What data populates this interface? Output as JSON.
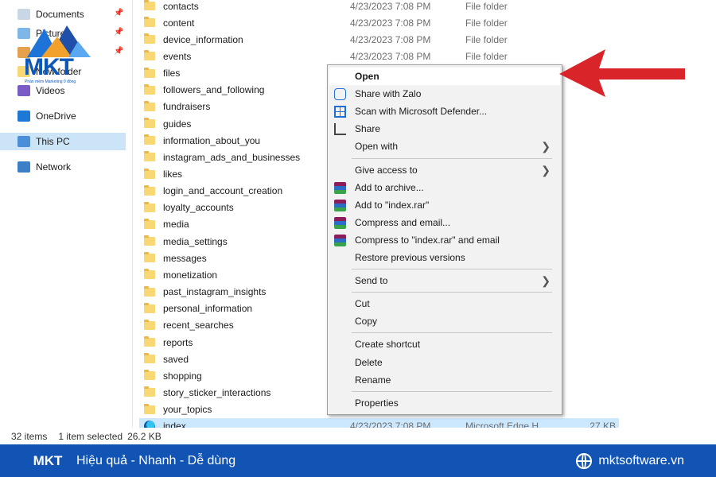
{
  "nav": {
    "items": [
      {
        "label": "Documents",
        "icon": "documents-icon",
        "pinned": true
      },
      {
        "label": "Pictures",
        "icon": "pictures-icon",
        "pinned": true
      },
      {
        "label": "Music",
        "icon": "music-icon",
        "pinned": true
      },
      {
        "label": "New folder",
        "icon": "folder-icon",
        "pinned": false
      },
      {
        "label": "Videos",
        "icon": "videos-icon",
        "pinned": false
      },
      {
        "label": "OneDrive",
        "icon": "onedrive-icon",
        "pinned": false
      },
      {
        "label": "This PC",
        "icon": "this-pc-icon",
        "pinned": false,
        "selected": true
      },
      {
        "label": "Network",
        "icon": "network-icon",
        "pinned": false
      }
    ]
  },
  "files": [
    {
      "name": "contacts",
      "date": "4/23/2023 7:08 PM",
      "type": "File folder",
      "size": ""
    },
    {
      "name": "content",
      "date": "4/23/2023 7:08 PM",
      "type": "File folder",
      "size": ""
    },
    {
      "name": "device_information",
      "date": "4/23/2023 7:08 PM",
      "type": "File folder",
      "size": ""
    },
    {
      "name": "events",
      "date": "4/23/2023 7:08 PM",
      "type": "File folder",
      "size": ""
    },
    {
      "name": "files",
      "date": "4/23/2023 7:08 PM",
      "type": "File folder",
      "size": ""
    },
    {
      "name": "followers_and_following",
      "date": "",
      "type": "",
      "size": ""
    },
    {
      "name": "fundraisers",
      "date": "",
      "type": "",
      "size": ""
    },
    {
      "name": "guides",
      "date": "",
      "type": "",
      "size": ""
    },
    {
      "name": "information_about_you",
      "date": "",
      "type": "",
      "size": ""
    },
    {
      "name": "instagram_ads_and_businesses",
      "date": "",
      "type": "",
      "size": ""
    },
    {
      "name": "likes",
      "date": "",
      "type": "",
      "size": ""
    },
    {
      "name": "login_and_account_creation",
      "date": "",
      "type": "",
      "size": ""
    },
    {
      "name": "loyalty_accounts",
      "date": "",
      "type": "",
      "size": ""
    },
    {
      "name": "media",
      "date": "",
      "type": "",
      "size": ""
    },
    {
      "name": "media_settings",
      "date": "",
      "type": "",
      "size": ""
    },
    {
      "name": "messages",
      "date": "",
      "type": "",
      "size": ""
    },
    {
      "name": "monetization",
      "date": "",
      "type": "",
      "size": ""
    },
    {
      "name": "past_instagram_insights",
      "date": "",
      "type": "",
      "size": ""
    },
    {
      "name": "personal_information",
      "date": "",
      "type": "",
      "size": ""
    },
    {
      "name": "recent_searches",
      "date": "",
      "type": "",
      "size": ""
    },
    {
      "name": "reports",
      "date": "",
      "type": "",
      "size": ""
    },
    {
      "name": "saved",
      "date": "",
      "type": "",
      "size": ""
    },
    {
      "name": "shopping",
      "date": "",
      "type": "",
      "size": ""
    },
    {
      "name": "story_sticker_interactions",
      "date": "",
      "type": "",
      "size": ""
    },
    {
      "name": "your_topics",
      "date": "",
      "type": "",
      "size": ""
    },
    {
      "name": "index",
      "date": "4/23/2023 7:08 PM",
      "type": "Microsoft Edge H...",
      "size": "27 KB",
      "selected": true,
      "icon": "edge-icon"
    }
  ],
  "context_menu": {
    "items": [
      {
        "label": "Open",
        "bold": true,
        "highlighted": true
      },
      {
        "label": "Share with Zalo",
        "icon": "zalo-icon"
      },
      {
        "label": "Scan with Microsoft Defender...",
        "icon": "defender-icon"
      },
      {
        "label": "Share",
        "icon": "share-icon"
      },
      {
        "label": "Open with",
        "submenu": true
      },
      {
        "separator": true
      },
      {
        "label": "Give access to",
        "submenu": true
      },
      {
        "label": "Add to archive...",
        "icon": "winrar-icon"
      },
      {
        "label": "Add to \"index.rar\"",
        "icon": "winrar-icon"
      },
      {
        "label": "Compress and email...",
        "icon": "winrar-icon"
      },
      {
        "label": "Compress to \"index.rar\" and email",
        "icon": "winrar-icon"
      },
      {
        "label": "Restore previous versions"
      },
      {
        "separator": true
      },
      {
        "label": "Send to",
        "submenu": true
      },
      {
        "separator": true
      },
      {
        "label": "Cut"
      },
      {
        "label": "Copy"
      },
      {
        "separator": true
      },
      {
        "label": "Create shortcut"
      },
      {
        "label": "Delete"
      },
      {
        "label": "Rename"
      },
      {
        "separator": true
      },
      {
        "label": "Properties"
      }
    ]
  },
  "status": {
    "item_count": "32 items",
    "selection": "1 item selected",
    "size": "26.2 KB"
  },
  "banner": {
    "logo_text": "MKT",
    "tagline": "Hiệu quả - Nhanh - Dễ dùng",
    "site": "mktsoftware.vn"
  },
  "logo": {
    "text": "MKT",
    "subtitle": "Phần mềm Marketing 0 đồng"
  },
  "colors": {
    "accent": "#1254b3",
    "selection": "#cce8ff",
    "arrow": "#d9252a"
  }
}
